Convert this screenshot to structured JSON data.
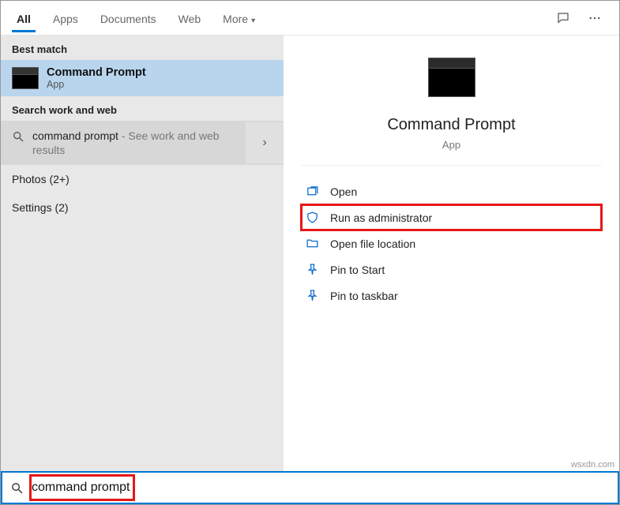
{
  "tabs": {
    "all": "All",
    "apps": "Apps",
    "documents": "Documents",
    "web": "Web",
    "more": "More"
  },
  "left": {
    "best_match_label": "Best match",
    "best_match": {
      "title": "Command Prompt",
      "subtitle": "App"
    },
    "search_web_label": "Search work and web",
    "web_result": {
      "query": "command prompt",
      "hint": " - See work and web results"
    },
    "photos": "Photos (2+)",
    "settings": "Settings (2)"
  },
  "preview": {
    "title": "Command Prompt",
    "subtitle": "App"
  },
  "actions": {
    "open": "Open",
    "run_admin": "Run as administrator",
    "open_file_location": "Open file location",
    "pin_start": "Pin to Start",
    "pin_taskbar": "Pin to taskbar"
  },
  "search": {
    "value": "command prompt"
  },
  "watermark": "wsxdn.com"
}
